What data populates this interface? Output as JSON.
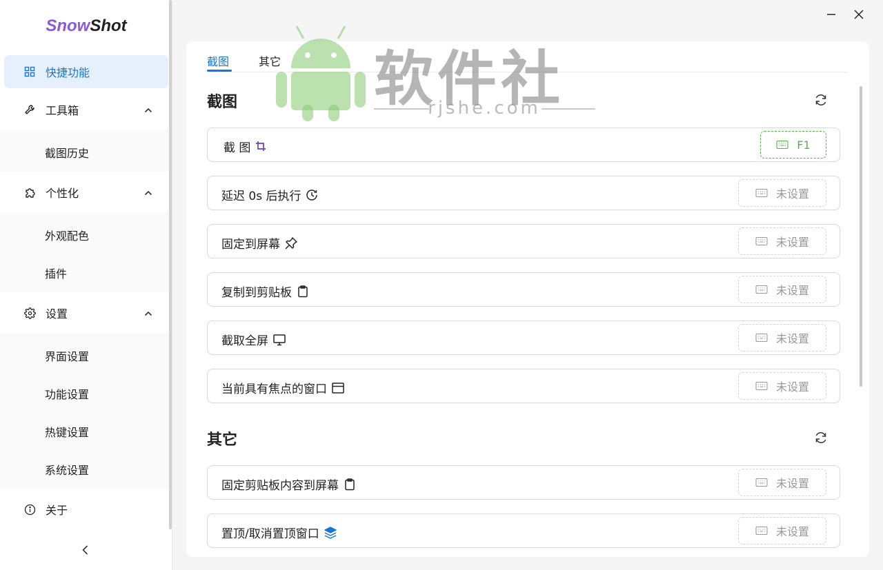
{
  "app": {
    "logo_part1": "Snow",
    "logo_part2": "Shot"
  },
  "sidebar": {
    "items": [
      {
        "label": "快捷功能",
        "icon": "grid-icon",
        "active": true
      },
      {
        "label": "工具箱",
        "icon": "wrench-icon"
      },
      {
        "label": "截图历史"
      },
      {
        "label": "个性化",
        "icon": "puzzle-icon"
      },
      {
        "label": "外观配色"
      },
      {
        "label": "插件"
      },
      {
        "label": "设置",
        "icon": "gear-icon"
      },
      {
        "label": "界面设置"
      },
      {
        "label": "功能设置"
      },
      {
        "label": "热键设置"
      },
      {
        "label": "系统设置"
      },
      {
        "label": "关于",
        "icon": "info-icon"
      }
    ]
  },
  "tabs": [
    {
      "label": "截图",
      "active": true
    },
    {
      "label": "其它"
    }
  ],
  "sections": [
    {
      "title": "截图",
      "rows": [
        {
          "label": "截 图",
          "icon": "crop-icon",
          "hotkey": "F1"
        },
        {
          "label": "延迟 0s 后执行",
          "icon": "clock-icon",
          "hotkey": "未设置"
        },
        {
          "label": "固定到屏幕",
          "icon": "pin-icon",
          "hotkey": "未设置"
        },
        {
          "label": "复制到剪贴板",
          "icon": "clipboard-icon",
          "hotkey": "未设置"
        },
        {
          "label": "截取全屏",
          "icon": "monitor-icon",
          "hotkey": "未设置"
        },
        {
          "label": "当前具有焦点的窗口",
          "icon": "window-icon",
          "hotkey": "未设置"
        }
      ]
    },
    {
      "title": "其它",
      "rows": [
        {
          "label": "固定剪贴板内容到屏幕",
          "icon": "clipboard-icon",
          "hotkey": "未设置"
        },
        {
          "label": "置顶/取消置顶窗口",
          "icon": "layers-icon",
          "hotkey": "未设置"
        }
      ]
    }
  ],
  "watermark": {
    "text": "软件社",
    "sub": "rjshe.com"
  },
  "colors": {
    "accent": "#1677d2",
    "set_hotkey": "#52b640",
    "logo_accent": "#8a5bd6"
  }
}
